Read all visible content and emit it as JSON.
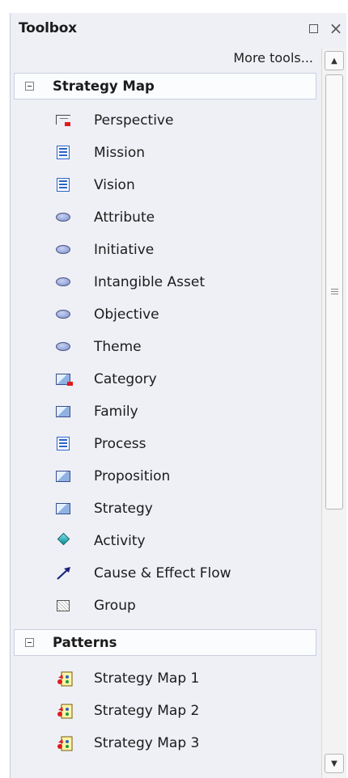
{
  "toolbox": {
    "title": "Toolbox",
    "more_tools": "More tools...",
    "close_glyph": "×"
  },
  "groups": [
    {
      "label": "Strategy Map",
      "expanded": true,
      "items": [
        {
          "label": "Perspective",
          "icon": "perspective-icon"
        },
        {
          "label": "Mission",
          "icon": "document-icon"
        },
        {
          "label": "Vision",
          "icon": "document-icon"
        },
        {
          "label": "Attribute",
          "icon": "ellipse-icon"
        },
        {
          "label": "Initiative",
          "icon": "ellipse-icon"
        },
        {
          "label": "Intangible Asset",
          "icon": "ellipse-icon"
        },
        {
          "label": "Objective",
          "icon": "ellipse-icon"
        },
        {
          "label": "Theme",
          "icon": "ellipse-icon"
        },
        {
          "label": "Category",
          "icon": "category-icon"
        },
        {
          "label": "Family",
          "icon": "rectangle-icon"
        },
        {
          "label": "Process",
          "icon": "document-icon"
        },
        {
          "label": "Proposition",
          "icon": "rectangle-icon"
        },
        {
          "label": "Strategy",
          "icon": "rectangle-icon"
        },
        {
          "label": "Activity",
          "icon": "diamond-icon"
        },
        {
          "label": "Cause & Effect Flow",
          "icon": "arrow-icon"
        },
        {
          "label": "Group",
          "icon": "group-icon"
        }
      ]
    },
    {
      "label": "Patterns",
      "expanded": true,
      "items": [
        {
          "label": "Strategy Map 1",
          "icon": "pattern-icon"
        },
        {
          "label": "Strategy Map 2",
          "icon": "pattern-icon"
        },
        {
          "label": "Strategy Map 3",
          "icon": "pattern-icon"
        }
      ]
    }
  ],
  "colors": {
    "panel_background": "#eef0f6",
    "header_background": "#fbfcfe",
    "accent_red": "#e01b1b",
    "document_blue": "#2a63c6"
  }
}
